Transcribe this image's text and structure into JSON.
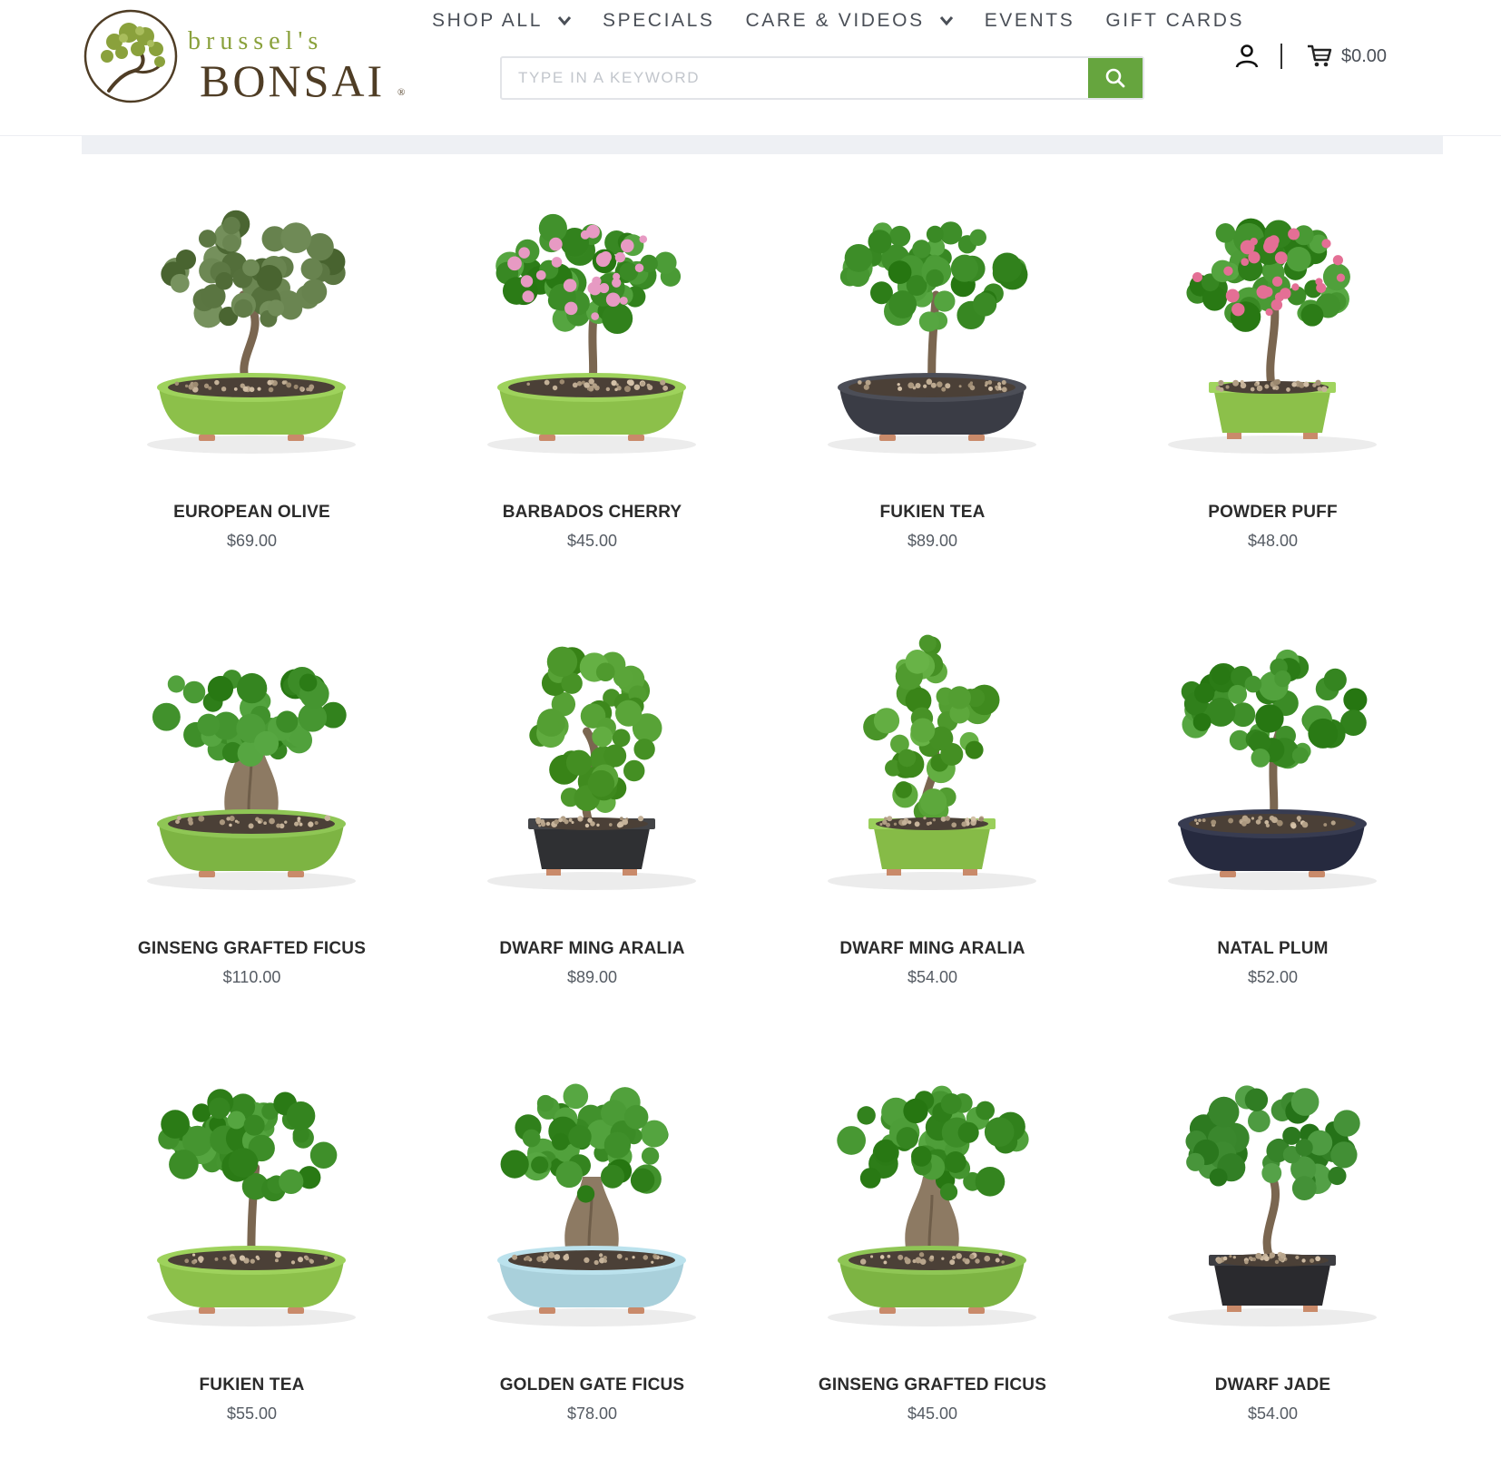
{
  "brand": {
    "script_text": "brussel's",
    "word_text": "BONSAI",
    "reg_mark": "®",
    "green": "#8aa13c",
    "brown": "#4f3d25"
  },
  "nav": {
    "items": [
      {
        "label": "SHOP ALL",
        "has_dropdown": true
      },
      {
        "label": "SPECIALS",
        "has_dropdown": false
      },
      {
        "label": "CARE & VIDEOS",
        "has_dropdown": true
      },
      {
        "label": "EVENTS",
        "has_dropdown": false
      },
      {
        "label": "GIFT CARDS",
        "has_dropdown": false
      }
    ]
  },
  "search": {
    "placeholder": "TYPE IN A KEYWORD",
    "value": "",
    "button_icon": "search-icon",
    "button_color": "#66a53e"
  },
  "header_actions": {
    "account_icon": "user-icon",
    "cart_icon": "cart-icon",
    "cart_total": "$0.00"
  },
  "products": [
    {
      "name": "EUROPEAN OLIVE",
      "price": "$69.00",
      "pot": "green-round",
      "pot_color": "#8cc04a",
      "foliage": "olive",
      "flowers": ""
    },
    {
      "name": "BARBADOS CHERRY",
      "price": "$45.00",
      "pot": "green-round",
      "pot_color": "#8cc04a",
      "foliage": "broad",
      "flowers": "#e79ac3"
    },
    {
      "name": "FUKIEN TEA",
      "price": "$89.00",
      "pot": "dark-round",
      "pot_color": "#3a3c45",
      "foliage": "broad",
      "flowers": ""
    },
    {
      "name": "POWDER PUFF",
      "price": "$48.00",
      "pot": "green-rect",
      "pot_color": "#8cc04a",
      "foliage": "broad",
      "flowers": "#e46f95"
    },
    {
      "name": "GINSENG GRAFTED FICUS",
      "price": "$110.00",
      "pot": "green-round",
      "pot_color": "#7db443",
      "foliage": "ficus",
      "flowers": ""
    },
    {
      "name": "DWARF MING ARALIA",
      "price": "$89.00",
      "pot": "dark-rect",
      "pot_color": "#2f3033",
      "foliage": "aralia",
      "flowers": ""
    },
    {
      "name": "DWARF MING ARALIA",
      "price": "$54.00",
      "pot": "green-rect",
      "pot_color": "#86bb47",
      "foliage": "aralia",
      "flowers": ""
    },
    {
      "name": "NATAL PLUM",
      "price": "$52.00",
      "pot": "navy-round",
      "pot_color": "#262a3f",
      "foliage": "broad",
      "flowers": ""
    },
    {
      "name": "FUKIEN TEA",
      "price": "$55.00",
      "pot": "green-round",
      "pot_color": "#8cc04a",
      "foliage": "broad",
      "flowers": ""
    },
    {
      "name": "GOLDEN GATE FICUS",
      "price": "$78.00",
      "pot": "blue-round",
      "pot_color": "#a9d0db",
      "foliage": "ficus",
      "flowers": ""
    },
    {
      "name": "GINSENG GRAFTED FICUS",
      "price": "$45.00",
      "pot": "green-round",
      "pot_color": "#7db443",
      "foliage": "ficus",
      "flowers": ""
    },
    {
      "name": "DWARF JADE",
      "price": "$54.00",
      "pot": "dark-rect",
      "pot_color": "#2a2a2e",
      "foliage": "jade",
      "flowers": ""
    }
  ]
}
